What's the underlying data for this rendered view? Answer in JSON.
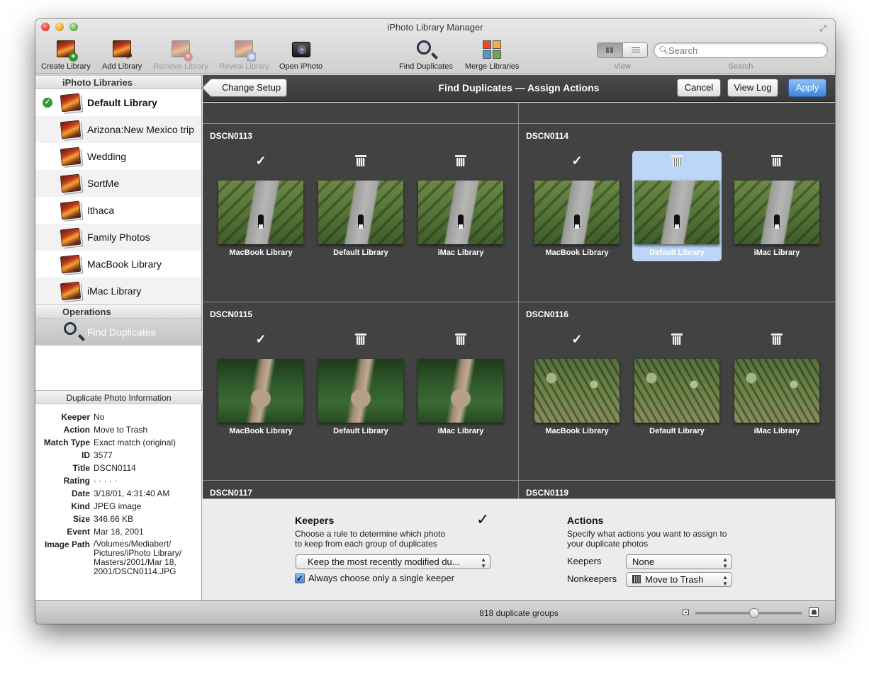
{
  "window": {
    "title": "iPhoto Library Manager"
  },
  "toolbar": {
    "items": [
      {
        "label": "Create Library",
        "enabled": true
      },
      {
        "label": "Add Library",
        "enabled": true
      },
      {
        "label": "Remove Library",
        "enabled": false
      },
      {
        "label": "Reveal Library",
        "enabled": false
      },
      {
        "label": "Open iPhoto",
        "enabled": true
      },
      {
        "label": "Find Duplicates",
        "enabled": true
      },
      {
        "label": "Merge Libraries",
        "enabled": true
      }
    ],
    "view_label": "View",
    "search_label": "Search",
    "search_placeholder": "Search"
  },
  "sidebar": {
    "libraries_header": "iPhoto Libraries",
    "libraries": [
      {
        "name": "Default Library",
        "active": true
      },
      {
        "name": "Arizona:New Mexico trip"
      },
      {
        "name": "Wedding"
      },
      {
        "name": "SortMe"
      },
      {
        "name": "Ithaca"
      },
      {
        "name": "Family Photos"
      },
      {
        "name": "MacBook Library"
      },
      {
        "name": "iMac Library"
      }
    ],
    "operations_header": "Operations",
    "operations": [
      {
        "name": "Find Duplicates",
        "selected": true
      }
    ]
  },
  "info": {
    "header": "Duplicate Photo Information",
    "rows": [
      {
        "key": "Keeper",
        "value": "No"
      },
      {
        "key": "Action",
        "value": "Move to Trash"
      },
      {
        "key": "Match Type",
        "value": "Exact match (original)"
      },
      {
        "key": "ID",
        "value": "3577"
      },
      {
        "key": "Title",
        "value": "DSCN0114"
      },
      {
        "key": "Rating",
        "value": "· · · · ·"
      },
      {
        "key": "Date",
        "value": "3/18/01, 4:31:40 AM"
      },
      {
        "key": "Kind",
        "value": "JPEG image"
      },
      {
        "key": "Size",
        "value": "346.66 KB"
      },
      {
        "key": "Event",
        "value": "Mar 18, 2001"
      },
      {
        "key": "Image Path",
        "value": "/Volumes/Mediabert/\nPictures/iPhoto Library/\nMasters/2001/Mar 18,\n2001/DSCN0114.JPG"
      }
    ]
  },
  "main": {
    "title": "Find Duplicates — Assign Actions",
    "back_label": "Change Setup",
    "cancel_label": "Cancel",
    "viewlog_label": "View Log",
    "apply_label": "Apply",
    "groups": [
      {
        "title": "DSCN0113",
        "image": "walk",
        "photos": [
          {
            "caption": "MacBook Library",
            "action": "keep",
            "mark": "✓"
          },
          {
            "caption": "Default Library",
            "action": "trash"
          },
          {
            "caption": "iMac Library",
            "action": "trash"
          }
        ]
      },
      {
        "title": "DSCN0114",
        "image": "walk",
        "photos": [
          {
            "caption": "MacBook Library",
            "action": "keep",
            "mark": "✓"
          },
          {
            "caption": "Default Library",
            "action": "trash",
            "selected": true
          },
          {
            "caption": "iMac Library",
            "action": "trash"
          }
        ]
      },
      {
        "title": "DSCN0115",
        "image": "alley",
        "photos": [
          {
            "caption": "MacBook Library",
            "action": "keep",
            "mark": "✓"
          },
          {
            "caption": "Default Library",
            "action": "trash"
          },
          {
            "caption": "iMac Library",
            "action": "trash"
          }
        ]
      },
      {
        "title": "DSCN0116",
        "image": "oaks",
        "photos": [
          {
            "caption": "MacBook Library",
            "action": "keep",
            "mark": "✓"
          },
          {
            "caption": "Default Library",
            "action": "trash"
          },
          {
            "caption": "iMac Library",
            "action": "trash"
          }
        ]
      },
      {
        "title": "DSCN0117",
        "image": "",
        "photos": []
      },
      {
        "title": "DSCN0119",
        "image": "",
        "photos": []
      }
    ]
  },
  "keepers": {
    "title": "Keepers",
    "check_mark": "✓",
    "desc": "Choose a rule to determine which photo\nto keep from each group of duplicates",
    "rule": "Keep the most recently modified du...",
    "single_checkbox_mark": "✓",
    "single_label": "Always choose only a single keeper"
  },
  "actions": {
    "title": "Actions",
    "desc": "Specify what actions you want to assign to\nyour duplicate photos",
    "keepers_label": "Keepers",
    "keepers_value": "None",
    "nonkeepers_label": "Nonkeepers",
    "nonkeepers_value": "Move to Trash"
  },
  "status": {
    "text": "818 duplicate groups",
    "zoom_level": 0.55
  }
}
